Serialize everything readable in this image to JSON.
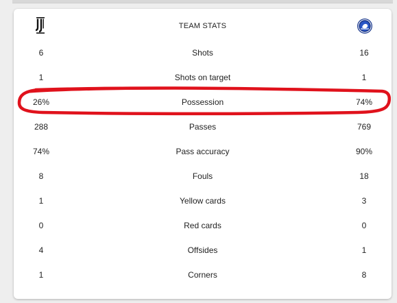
{
  "header": {
    "title": "TEAM STATS",
    "home_logo": "juventus-logo",
    "away_logo": "chelsea-logo"
  },
  "stats": [
    {
      "home": "6",
      "label": "Shots",
      "away": "16"
    },
    {
      "home": "1",
      "label": "Shots on target",
      "away": "1"
    },
    {
      "home": "26%",
      "label": "Possession",
      "away": "74%"
    },
    {
      "home": "288",
      "label": "Passes",
      "away": "769"
    },
    {
      "home": "74%",
      "label": "Pass accuracy",
      "away": "90%"
    },
    {
      "home": "8",
      "label": "Fouls",
      "away": "18"
    },
    {
      "home": "1",
      "label": "Yellow cards",
      "away": "3"
    },
    {
      "home": "0",
      "label": "Red cards",
      "away": "0"
    },
    {
      "home": "4",
      "label": "Offsides",
      "away": "1"
    },
    {
      "home": "1",
      "label": "Corners",
      "away": "8"
    }
  ],
  "colors": {
    "highlight": "#e0121c",
    "chelsea_blue": "#1d3b8f"
  }
}
